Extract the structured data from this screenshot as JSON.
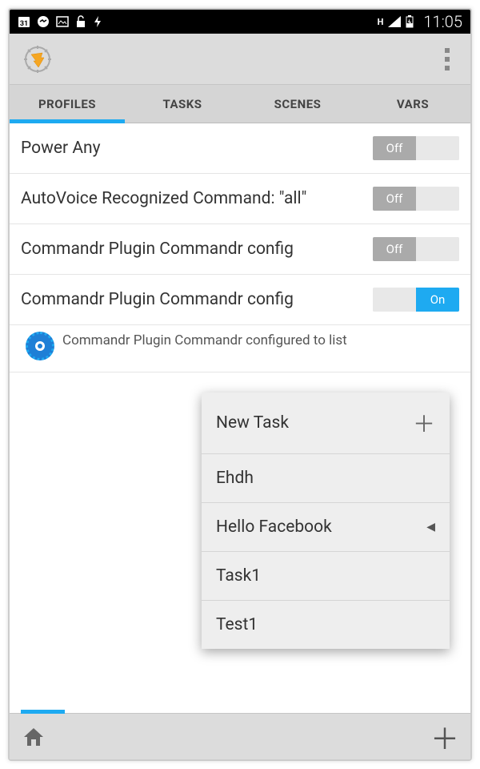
{
  "status": {
    "time": "11:05",
    "network": "H"
  },
  "tabs": {
    "profiles": "PROFILES",
    "tasks": "TASKS",
    "scenes": "SCENES",
    "vars": "VARS"
  },
  "toggle_labels": {
    "off": "Off",
    "on": "On"
  },
  "profiles": [
    {
      "label": "Power Any",
      "state": "off"
    },
    {
      "label": "AutoVoice Recognized Command: \"all\"",
      "state": "off"
    },
    {
      "label": "Commandr Plugin Commandr config",
      "state": "off"
    },
    {
      "label": "Commandr Plugin Commandr config",
      "state": "on"
    }
  ],
  "detail": {
    "text": "Commandr Plugin Commandr configured to list"
  },
  "popup": {
    "new_task": "New Task",
    "items": [
      "Ehdh",
      "Hello Facebook",
      "Task1",
      "Test1"
    ]
  }
}
